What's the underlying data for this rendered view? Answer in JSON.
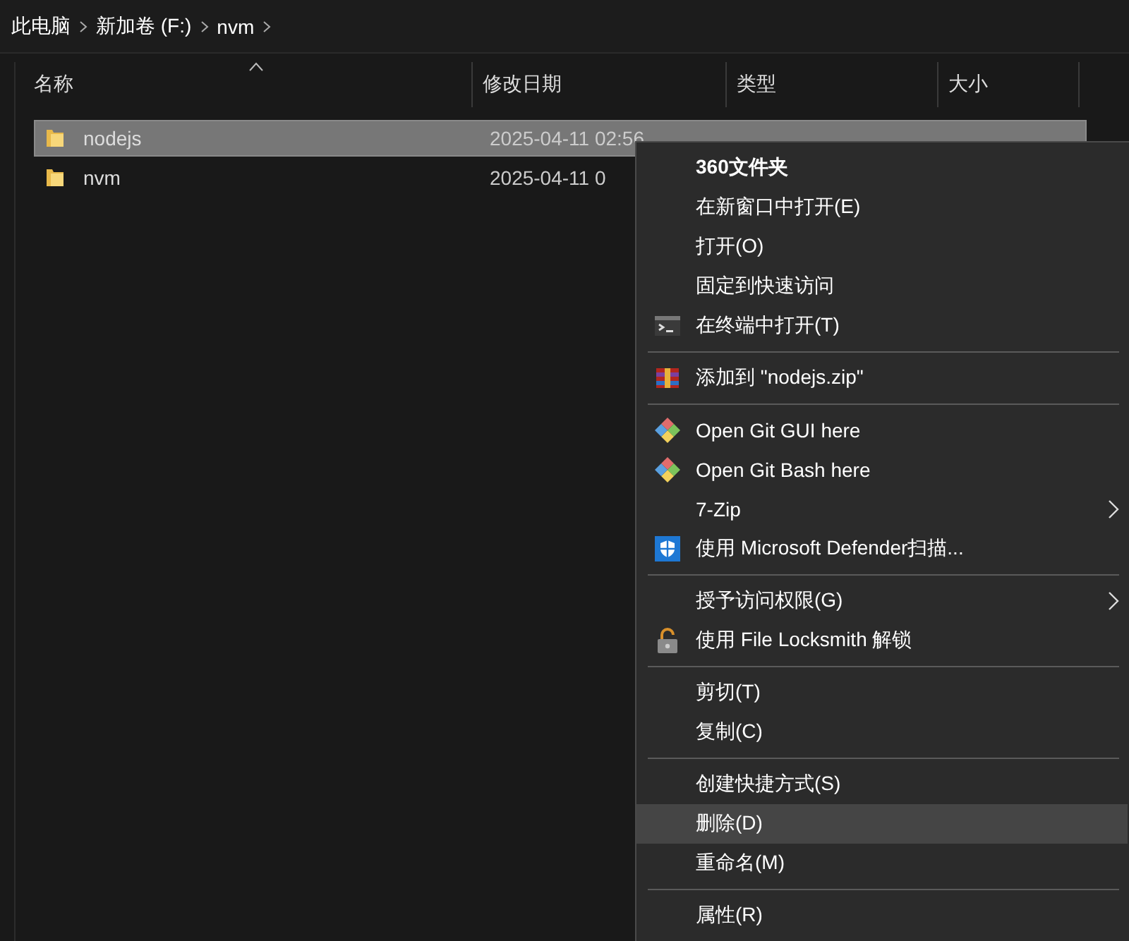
{
  "breadcrumb": [
    "此电脑",
    "新加卷 (F:)",
    "nvm"
  ],
  "columns": [
    {
      "label": "名称",
      "sorted": true
    },
    {
      "label": "修改日期",
      "sorted": false
    },
    {
      "label": "类型",
      "sorted": false
    },
    {
      "label": "大小",
      "sorted": false
    }
  ],
  "rows": [
    {
      "name": "nodejs",
      "date": "2025-04-11 02:56",
      "selected": true
    },
    {
      "name": "nvm",
      "date": "2025-04-11 0",
      "selected": false
    }
  ],
  "context_menu": {
    "groups": [
      [
        {
          "label": "360文件夹",
          "default": true,
          "selected": false
        },
        {
          "label": "在新窗口中打开(E)",
          "selected": false
        },
        {
          "label": "打开(O)",
          "selected": false
        },
        {
          "label": "固定到快速访问",
          "selected": false
        },
        {
          "label": "在终端中打开(T)",
          "selected": false
        }
      ],
      [
        {
          "label": "添加到 \"nodejs.zip\"",
          "selected": false
        }
      ],
      [
        {
          "label": "Open Git GUI here",
          "selected": false
        },
        {
          "label": "Open Git Bash here",
          "selected": false
        },
        {
          "label": "7-Zip",
          "submenu": true,
          "selected": false
        },
        {
          "label": "使用 Microsoft Defender扫描...",
          "selected": false
        }
      ],
      [
        {
          "label": "授予访问权限(G)",
          "submenu": true,
          "selected": false
        },
        {
          "label": "使用 File Locksmith 解锁",
          "selected": false
        }
      ],
      [
        {
          "label": "剪切(T)",
          "selected": false
        },
        {
          "label": "复制(C)",
          "selected": false
        }
      ],
      [
        {
          "label": "创建快捷方式(S)",
          "selected": false
        },
        {
          "label": "删除(D)",
          "selected": true
        },
        {
          "label": "重命名(M)",
          "selected": false
        }
      ],
      [
        {
          "label": "属性(R)",
          "selected": false
        }
      ]
    ]
  }
}
